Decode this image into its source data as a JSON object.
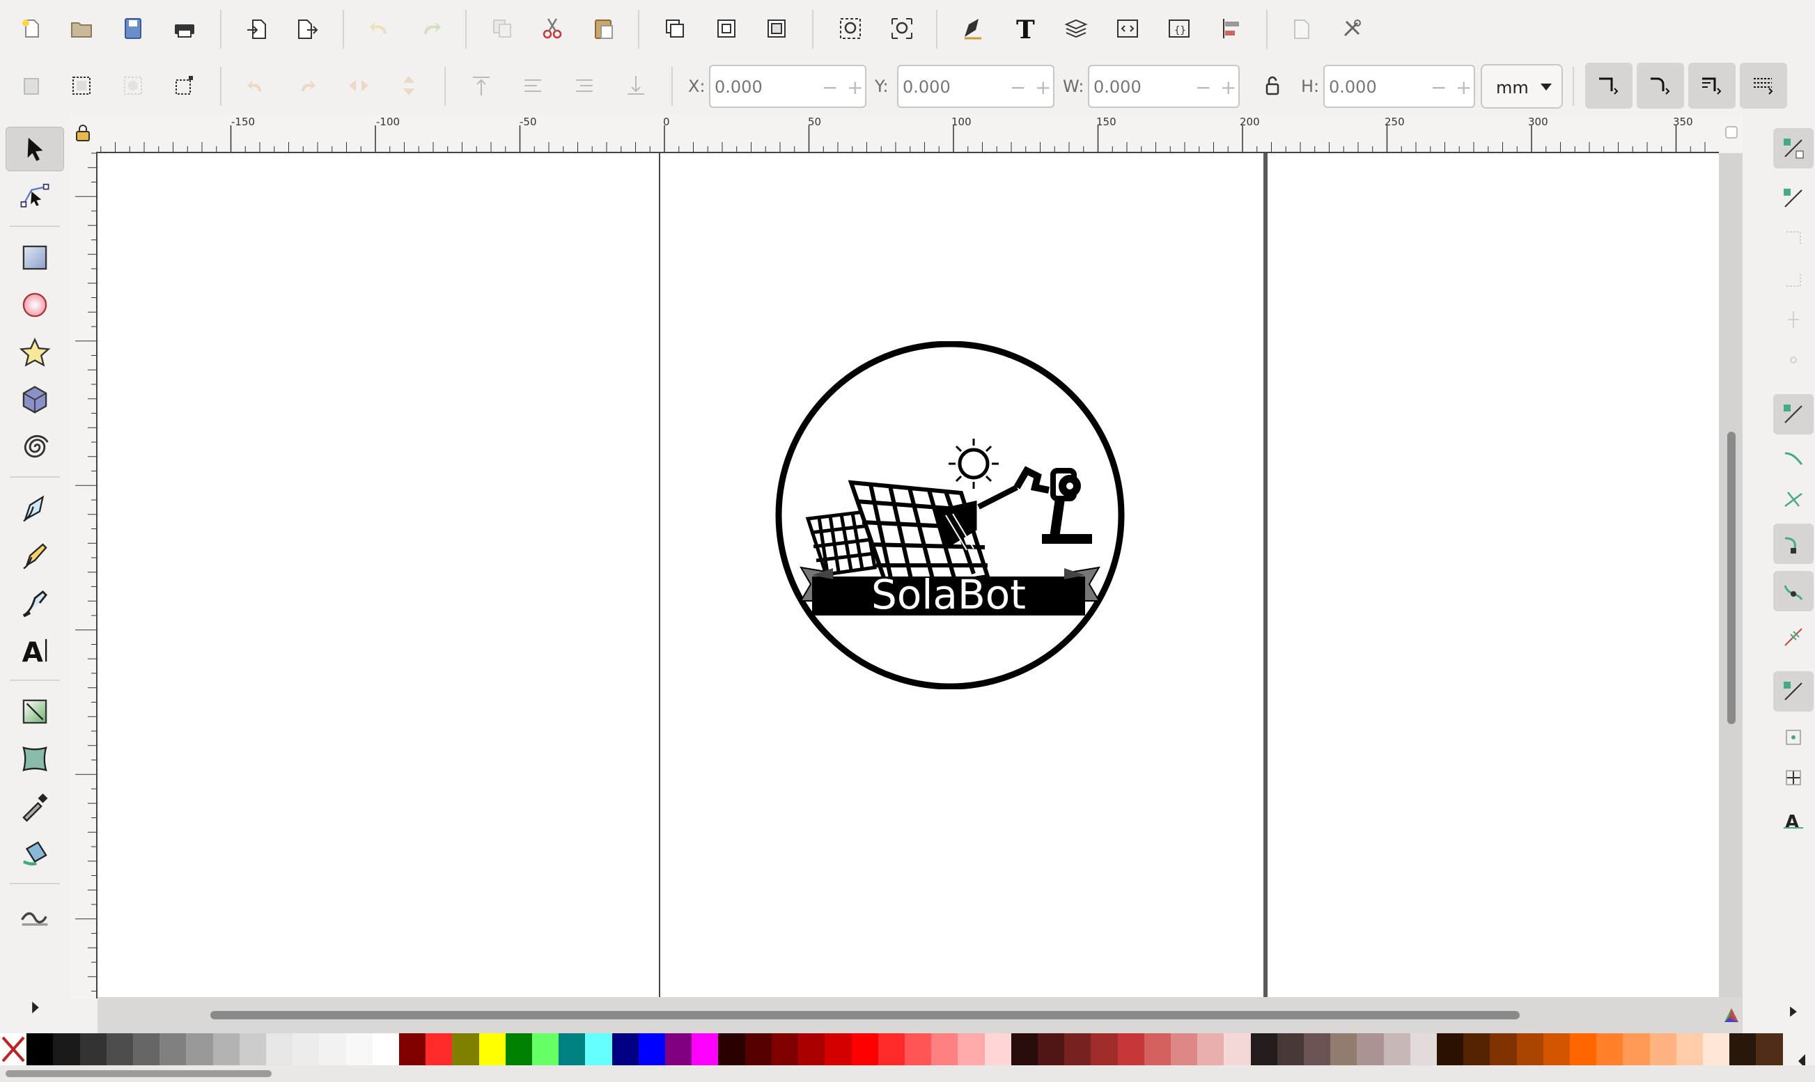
{
  "toolbar": {
    "items": [
      "new-document-icon",
      "open-folder-icon",
      "save-icon",
      "print-icon",
      "import-icon",
      "export-icon",
      "undo-icon",
      "redo-icon",
      "copy-icon",
      "cut-icon",
      "paste-icon",
      "duplicate-icon",
      "clone-icon",
      "unlink-clone-icon",
      "zoom-selection-icon",
      "zoom-drawing-icon",
      "fill-stroke-icon",
      "text-font-icon",
      "layers-icon",
      "xml-editor-icon",
      "selectors-css-icon",
      "align-distribute-icon",
      "document-properties-icon",
      "preferences-icon"
    ]
  },
  "controls": {
    "x_label": "X:",
    "x_value": "0.000",
    "y_label": "Y:",
    "y_value": "0.000",
    "w_label": "W:",
    "w_value": "0.000",
    "h_label": "H:",
    "h_value": "0.000",
    "unit": "mm"
  },
  "ruler": {
    "labels": [
      "-150",
      "-100",
      "-50",
      "0",
      "50",
      "100",
      "150",
      "200",
      "250",
      "300",
      "350"
    ]
  },
  "canvas": {
    "logo_text": "SolaBot"
  },
  "palette": [
    "none",
    "#000000",
    "#1a1a1a",
    "#333333",
    "#4d4d4d",
    "#666666",
    "#808080",
    "#999999",
    "#b3b3b3",
    "#cccccc",
    "#e6e6e6",
    "#ececec",
    "#f2f2f2",
    "#f8f8f8",
    "#ffffff",
    "#800000",
    "#ff2a2a",
    "#808000",
    "#ffff00",
    "#008000",
    "#66ff66",
    "#008080",
    "#66ffff",
    "#000080",
    "#0000ff",
    "#800080",
    "#ff00ff",
    "#2b0000",
    "#550000",
    "#800000",
    "#aa0000",
    "#d40000",
    "#ff0000",
    "#ff2a2a",
    "#ff5555",
    "#ff8080",
    "#ffaaaa",
    "#ffd5d5",
    "#280b0b",
    "#501616",
    "#782121",
    "#a02c2c",
    "#c83737",
    "#d35f5f",
    "#de8787",
    "#e9afaf",
    "#f4d7d7",
    "#241c1c",
    "#483737",
    "#6c5353",
    "#917c6f",
    "#ac9393",
    "#c8b7b7",
    "#e3dbdb",
    "#2b1100",
    "#552200",
    "#803300",
    "#aa4400",
    "#d45500",
    "#ff6600",
    "#ff7f2a",
    "#ff9955",
    "#ffb380",
    "#ffccaa",
    "#ffe6d5",
    "#28170b",
    "#502d16"
  ]
}
